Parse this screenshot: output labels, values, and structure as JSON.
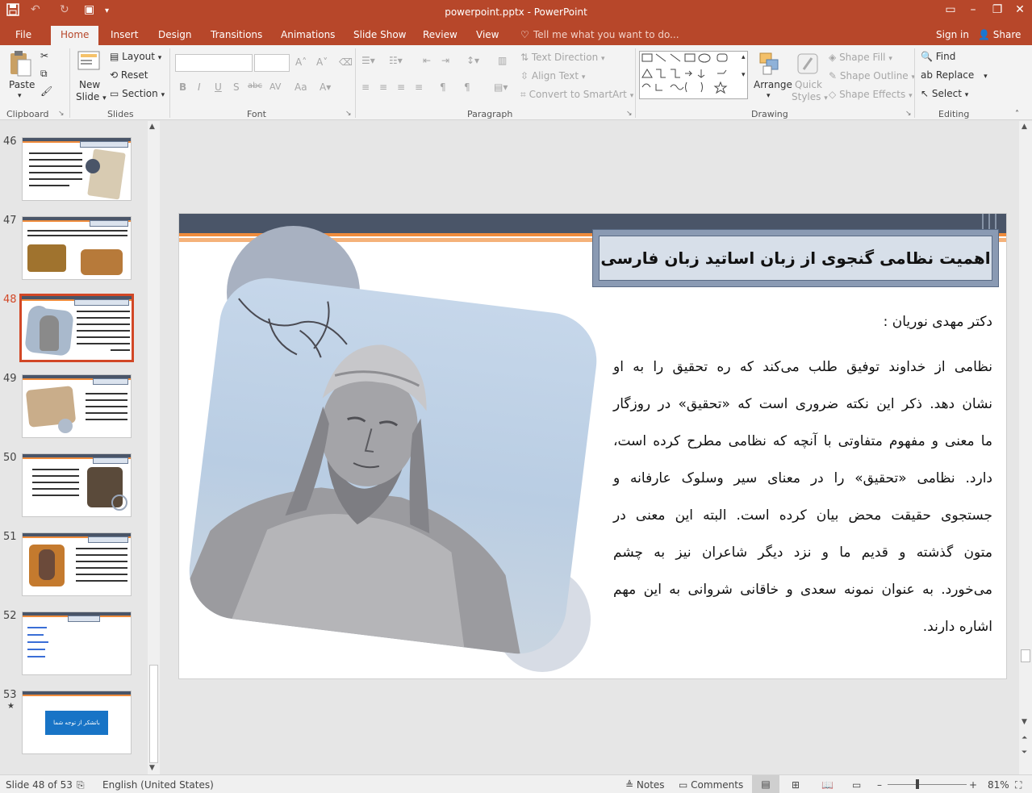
{
  "window": {
    "title": "powerpoint.pptx - PowerPoint"
  },
  "tabs": [
    "File",
    "Home",
    "Insert",
    "Design",
    "Transitions",
    "Animations",
    "Slide Show",
    "Review",
    "View"
  ],
  "active_tab": "Home",
  "tell_me": "Tell me what you want to do...",
  "account": {
    "signin": "Sign in",
    "share": "Share"
  },
  "ribbon": {
    "clipboard": {
      "group": "Clipboard",
      "paste": "Paste"
    },
    "slides": {
      "group": "Slides",
      "new_slide_1": "New",
      "new_slide_2": "Slide",
      "layout": "Layout",
      "reset": "Reset",
      "section": "Section"
    },
    "font": {
      "group": "Font",
      "bold": "B",
      "italic": "I",
      "underline": "U",
      "shadow": "S",
      "strike": "abc",
      "spacing": "AV",
      "case": "Aa"
    },
    "paragraph": {
      "group": "Paragraph",
      "text_direction": "Text Direction",
      "align_text": "Align Text",
      "smartart": "Convert to SmartArt"
    },
    "drawing": {
      "group": "Drawing",
      "arrange": "Arrange",
      "quick_styles_1": "Quick",
      "quick_styles_2": "Styles",
      "shape_fill": "Shape Fill",
      "shape_outline": "Shape Outline",
      "shape_effects": "Shape Effects"
    },
    "editing": {
      "group": "Editing",
      "find": "Find",
      "replace": "Replace",
      "select": "Select"
    }
  },
  "thumbnails": [
    {
      "num": "46"
    },
    {
      "num": "47"
    },
    {
      "num": "48"
    },
    {
      "num": "49"
    },
    {
      "num": "50"
    },
    {
      "num": "51"
    },
    {
      "num": "52"
    },
    {
      "num": "53",
      "star": "★",
      "button": "باتشکر از توجه شما"
    }
  ],
  "selected_slide": "48",
  "slide": {
    "title": "اهمیت نظامی گنجوی از زبان اساتید زبان فارسی",
    "author": "دکتر مهدی نوریان :",
    "body": [
      "نظامی از خداوند توفیق طلب می‌کند که ره تحقیق را به او",
      "نشان دهد. ذکر این نکته ضروری است که «تحقیق» در روزگار",
      "ما معنی و مفهوم متفاوتی با آنچه که نظامی مطرح کرده است،",
      "دارد. نظامی «تحقیق» را در معنای سیر وسلوک عارفانه و",
      "جستجوی حقیقت محض بیان کرده است. البته این معنی در",
      "متون گذشته و قدیم ما و نزد دیگر شاعران نیز به چشم",
      "می‌خورد. به عنوان نمونه سعدی و خاقانی شروانی به این مهم",
      "اشاره دارند."
    ]
  },
  "status": {
    "slide_info": "Slide 48 of 53",
    "language": "English (United States)",
    "notes": "Notes",
    "comments": "Comments",
    "zoom": "81%"
  },
  "colors": {
    "accent": "#b7472a",
    "header_bar": "#4a5568",
    "orange": "#f08c3c"
  }
}
